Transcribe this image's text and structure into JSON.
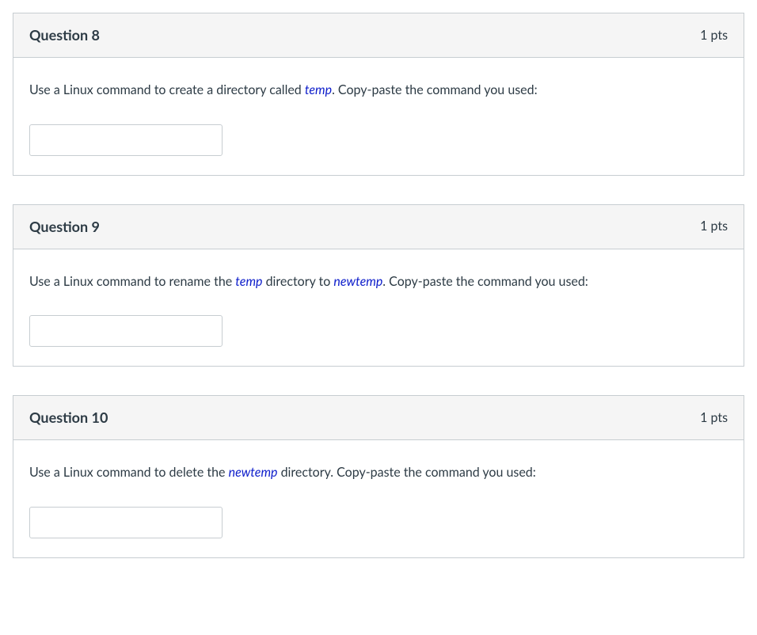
{
  "questions": [
    {
      "title": "Question 8",
      "points": "1 pts",
      "prompt_parts": [
        {
          "text": "Use a Linux command to create a directory called ",
          "italic": false
        },
        {
          "text": "temp",
          "italic": true
        },
        {
          "text": ". Copy-paste the command you used:",
          "italic": false
        }
      ],
      "answer_value": ""
    },
    {
      "title": "Question 9",
      "points": "1 pts",
      "prompt_parts": [
        {
          "text": "Use a Linux command to rename the ",
          "italic": false
        },
        {
          "text": "temp",
          "italic": true
        },
        {
          "text": " directory to ",
          "italic": false
        },
        {
          "text": "newtemp",
          "italic": true
        },
        {
          "text": ". Copy-paste the command you used:",
          "italic": false
        }
      ],
      "answer_value": ""
    },
    {
      "title": "Question 10",
      "points": "1 pts",
      "prompt_parts": [
        {
          "text": "Use a Linux command to delete the ",
          "italic": false
        },
        {
          "text": "newtemp",
          "italic": true
        },
        {
          "text": " directory. Copy-paste the command you used:",
          "italic": false
        }
      ],
      "answer_value": ""
    }
  ]
}
